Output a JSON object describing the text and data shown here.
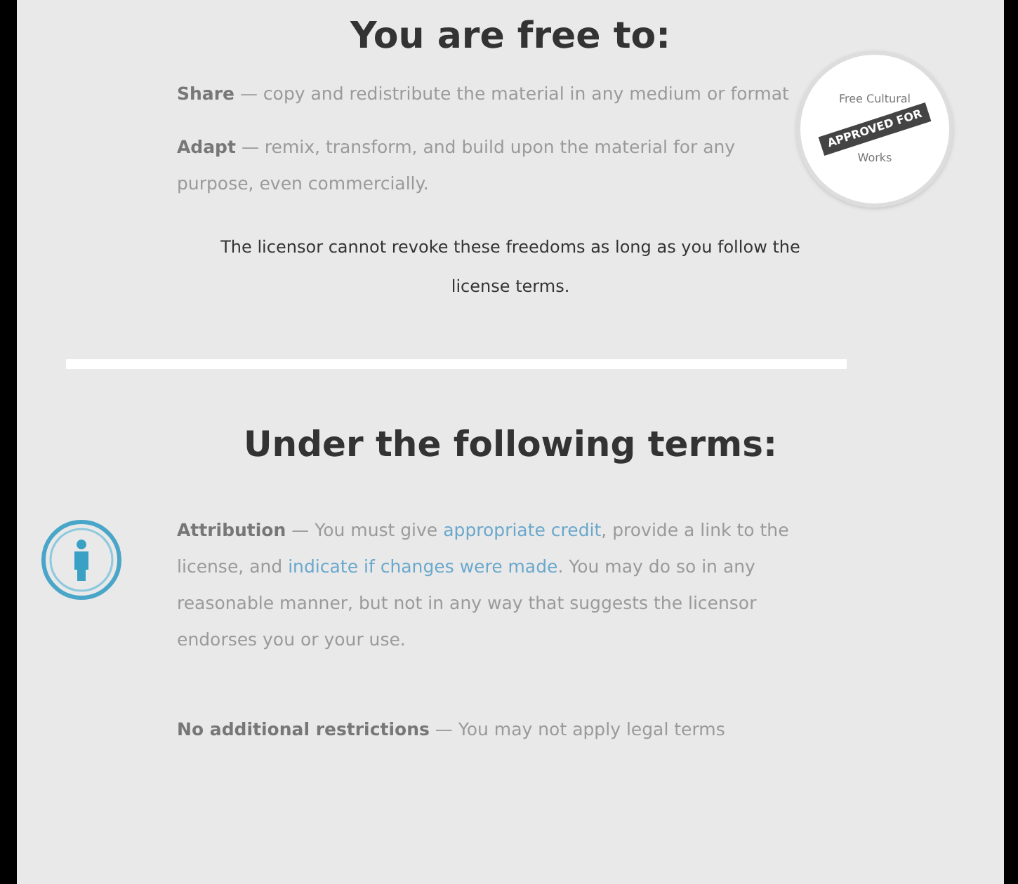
{
  "freedoms_heading": "You are free to:",
  "badge": {
    "top_text": "Free Cultural",
    "banner": "APPROVED FOR",
    "bottom_text": "Works"
  },
  "freedoms": [
    {
      "term": "Share",
      "text": " — copy and redistribute the material in any medium or format"
    },
    {
      "term": "Adapt",
      "text": " — remix, transform, and build upon the material for any purpose, even commercially."
    }
  ],
  "freedoms_note": "The licensor cannot revoke these freedoms as long as you follow the license terms.",
  "terms_heading": "Under the following terms:",
  "terms": [
    {
      "kind": "icon",
      "term": "Attribution",
      "parts": [
        {
          "text": " — You must give ",
          "link": false
        },
        {
          "text": "appropriate credit",
          "link": true
        },
        {
          "text": ", provide a link to the license, and ",
          "link": false
        },
        {
          "text": "indicate if changes were made",
          "link": true
        },
        {
          "text": ". You may do so in any reasonable manner, but not in any way that suggests the licensor endorses you or your use.",
          "link": false
        }
      ]
    },
    {
      "kind": "plain",
      "term": "No additional restrictions",
      "parts": [
        {
          "text": " — You may not apply legal terms",
          "link": false
        }
      ]
    }
  ]
}
